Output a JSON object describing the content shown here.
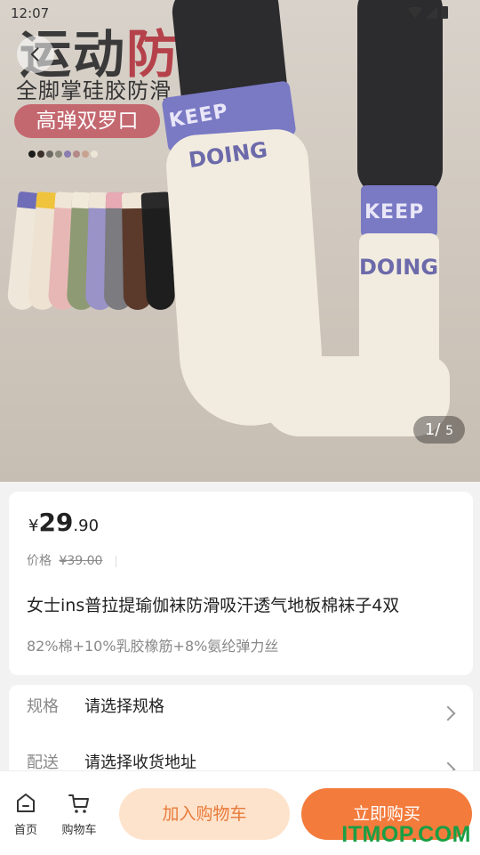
{
  "status": {
    "time": "12:07"
  },
  "hero": {
    "title_part1": "运动",
    "title_part2": "防滑",
    "subtitle": "全脚掌硅胶防滑",
    "tag": "高弹双罗口",
    "swatches": [
      "#1b1b1b",
      "#3a3029",
      "#6b6a64",
      "#8b8a7a",
      "#8a7db0",
      "#b38a86",
      "#c9a391",
      "#ede6d6"
    ],
    "brand_band": "KEEP",
    "brand_text": "DOING",
    "pager_current": "1",
    "pager_total": "5"
  },
  "price": {
    "currency": "¥",
    "integer": "29",
    "decimal": ".90",
    "original_label": "价格",
    "original_price": "¥39.00"
  },
  "product": {
    "title": "女士ins普拉提瑜伽袜防滑吸汗透气地板棉袜子4双",
    "description": "82%棉+10%乳胶橡筋+8%氨纶弹力丝"
  },
  "specs": [
    {
      "key": "规格",
      "value": "请选择规格"
    },
    {
      "key": "配送",
      "value": "请选择收货地址"
    }
  ],
  "bottom_bar": {
    "home_label": "首页",
    "cart_label": "购物车",
    "add_to_cart": "加入购物车",
    "buy_now": "立即购买"
  },
  "watermark": "ITMOP.COM"
}
